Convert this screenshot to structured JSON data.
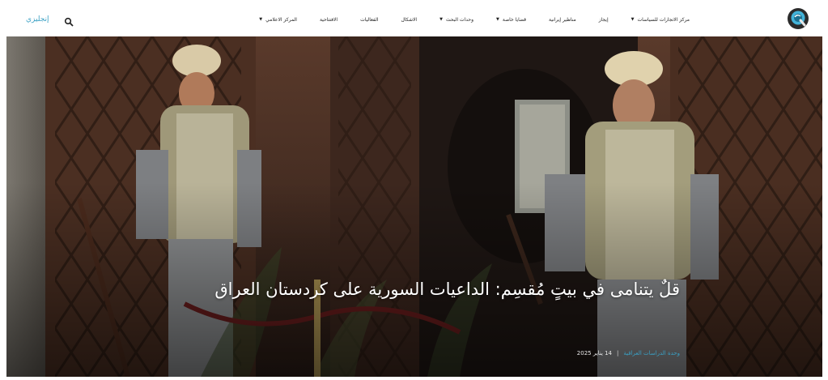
{
  "nav": {
    "lang_label": "إنجليزي",
    "items": [
      {
        "label": "مركز الاتجارات للسياسات",
        "dropdown": true
      },
      {
        "label": "إيجاز",
        "dropdown": false
      },
      {
        "label": "مناظير إيرانية",
        "dropdown": false
      },
      {
        "label": "قضايا خاصة",
        "dropdown": true
      },
      {
        "label": "وحدات البحث",
        "dropdown": true
      },
      {
        "label": "الاشكال",
        "dropdown": false
      },
      {
        "label": "الفعاليات",
        "dropdown": false
      },
      {
        "label": "الافتتاحية",
        "dropdown": false
      },
      {
        "label": "المركز الاعلامي",
        "dropdown": true
      }
    ]
  },
  "hero": {
    "title": "قلٌ يتنامى في بيتٍ مُقسِم: الداعيات السورية على كردستان العراق",
    "author": "وحدة الدراسات العراقية",
    "separator": "|",
    "date": "14 يناير 2025"
  },
  "colors": {
    "accent": "#3aa0c4",
    "hero_text": "#ffffff"
  }
}
